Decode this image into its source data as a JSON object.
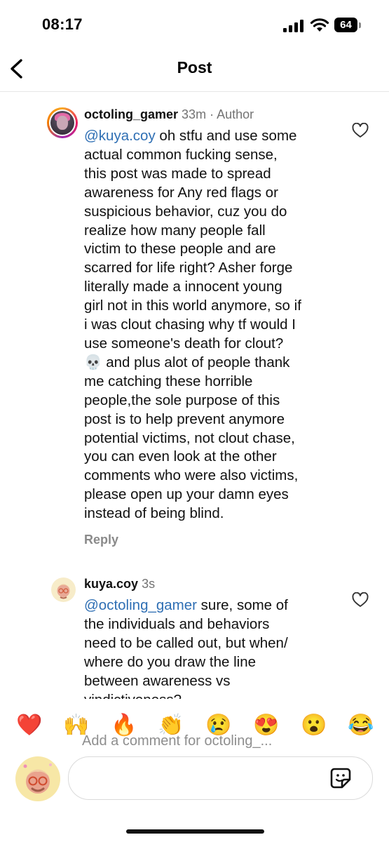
{
  "status_bar": {
    "time": "08:17",
    "battery": "64"
  },
  "header": {
    "title": "Post"
  },
  "comments": [
    {
      "username": "octoling_gamer",
      "age": "33m",
      "separator": " · ",
      "role": "Author",
      "mention": "@kuya.coy",
      "text": " oh stfu and use some\nactual common fucking sense,\nthis post was made to spread\nawareness for Any red flags or\nsuspicious behavior, cuz you do\nrealize how many people fall\nvictim to these people and are\nscarred for life right? Asher forge\nliterally made a innocent young\ngirl not in this world anymore, so if\ni was clout chasing why tf would I\nuse someone's death for clout?\n💀 and plus alot of people thank\nme catching these horrible\npeople,the sole purpose of this\npost is to help prevent anymore\npotential victims, not clout chase,\nyou can even look at the other\ncomments who were also victims,\nplease open up your damn eyes\ninstead of being blind.",
      "reply_label": "Reply"
    },
    {
      "username": "kuya.coy",
      "age": "3s",
      "mention": "@octoling_gamer",
      "text": " sure, some of\nthe individuals and behaviors\nneed to be called out, but when/\nwhere do you draw the line\nbetween awareness vs\nvindictiveness?"
    }
  ],
  "reactions": [
    "❤️",
    "🙌",
    "🔥",
    "👏",
    "😢",
    "😍",
    "😮",
    "😂"
  ],
  "composer": {
    "placeholder": "Add a comment for octoling_..."
  },
  "icons": {
    "back": "chevron-left-icon",
    "like": "heart-outline-icon",
    "sticker": "sticker-icon"
  }
}
